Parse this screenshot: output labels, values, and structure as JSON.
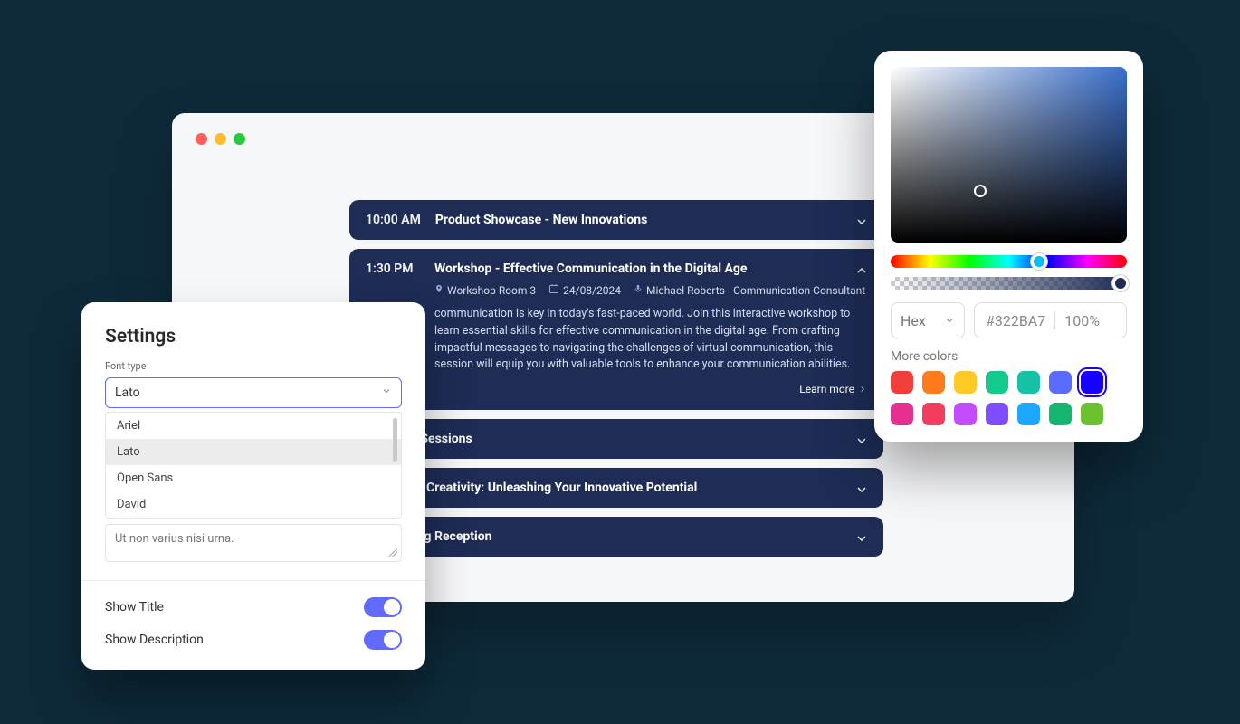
{
  "agenda": {
    "sessions": [
      {
        "time": "10:00 AM",
        "title": "Product Showcase - New Innovations",
        "expanded": false
      },
      {
        "time": "1:30 PM",
        "title": "Workshop - Effective Communication in the Digital Age",
        "expanded": true,
        "room": "Workshop Room 3",
        "date": "24/08/2024",
        "speaker": "Michael Roberts - Communication Consultant",
        "description": "communication is key in today's fast-paced world. Join this interactive workshop to learn essential skills for effective communication in the digital age. From crafting impactful messages to navigating the challenges of virtual communication, this session will equip you with valuable tools to enhance your communication abilities.",
        "learn_more": "Learn more"
      },
      {
        "time": "",
        "title": "Breakout Sessions"
      },
      {
        "time": "",
        "title": "The Art of Creativity: Unleashing Your Innovative Potential"
      },
      {
        "time": "",
        "title": "Networking Reception"
      }
    ]
  },
  "settings": {
    "title": "Settings",
    "font_type_label": "Font type",
    "font_value": "Lato",
    "font_options": [
      "Ariel",
      "Lato",
      "Open Sans",
      "David"
    ],
    "textarea_value": "Ut non varius nisi urna.",
    "show_title_label": "Show Title",
    "show_description_label": "Show Description"
  },
  "picker": {
    "mode": "Hex",
    "hex": "#322BA7",
    "opacity": "100%",
    "more_colors_label": "More colors",
    "swatches": [
      "#F23D3D",
      "#FF7A1A",
      "#FFC926",
      "#14C98C",
      "#16C2A3",
      "#5C6BFF",
      "#1800FF",
      "#E5308F",
      "#F23D5E",
      "#C54BFF",
      "#7D4DFF",
      "#1CA8FF",
      "#14B56E",
      "#6BC22E"
    ],
    "selected_index": 6
  }
}
